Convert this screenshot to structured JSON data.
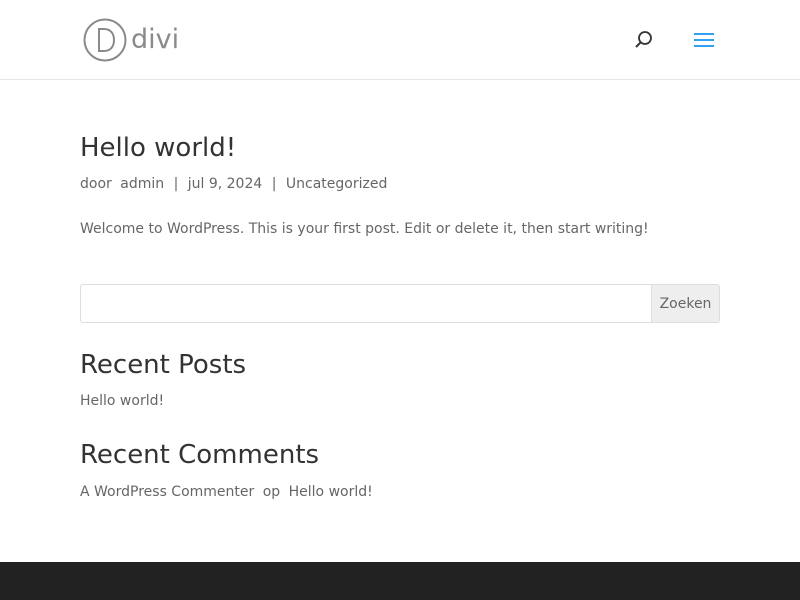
{
  "header": {
    "logo_text": "divi",
    "logo_icon": "divi-logo-icon",
    "search_icon": "search-icon",
    "menu_icon": "hamburger-menu-icon",
    "accent_color": "#2ea3f2"
  },
  "post": {
    "title": "Hello world!",
    "meta": {
      "by_label": "door",
      "author": "admin",
      "separator": "|",
      "date": "jul 9, 2024",
      "category": "Uncategorized"
    },
    "body": "Welcome to WordPress. This is your first post. Edit or delete it, then start writing!"
  },
  "search": {
    "placeholder": "",
    "value": "",
    "button_label": "Zoeken"
  },
  "widgets": {
    "recent_posts": {
      "title": "Recent Posts",
      "items": [
        {
          "label": "Hello world!"
        }
      ]
    },
    "recent_comments": {
      "title": "Recent Comments",
      "items": [
        {
          "author": "A WordPress Commenter",
          "on_label": "op",
          "post": "Hello world!"
        }
      ]
    }
  },
  "footer": {
    "background_color": "#222222"
  }
}
